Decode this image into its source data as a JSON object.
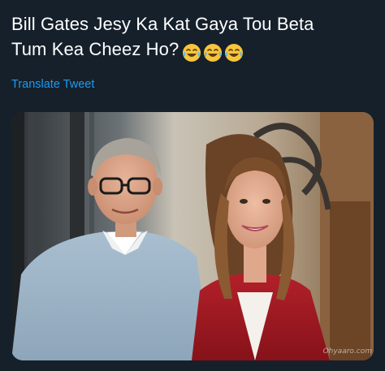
{
  "tweet": {
    "text_line1": "Bill Gates Jesy Ka Kat Gaya Tou Beta",
    "text_line2": "Tum Kea Cheez Ho?",
    "emojis": [
      "face-with-tears-of-joy-icon",
      "face-with-tears-of-joy-icon",
      "face-with-tears-of-joy-icon"
    ],
    "translate_label": "Translate Tweet"
  },
  "media": {
    "description_alt": "",
    "watermark": "Ohyaaro.com"
  },
  "colors": {
    "background": "#15202b",
    "text": "#ffffff",
    "link": "#1d9bf0",
    "emoji": "#f7c53b"
  }
}
